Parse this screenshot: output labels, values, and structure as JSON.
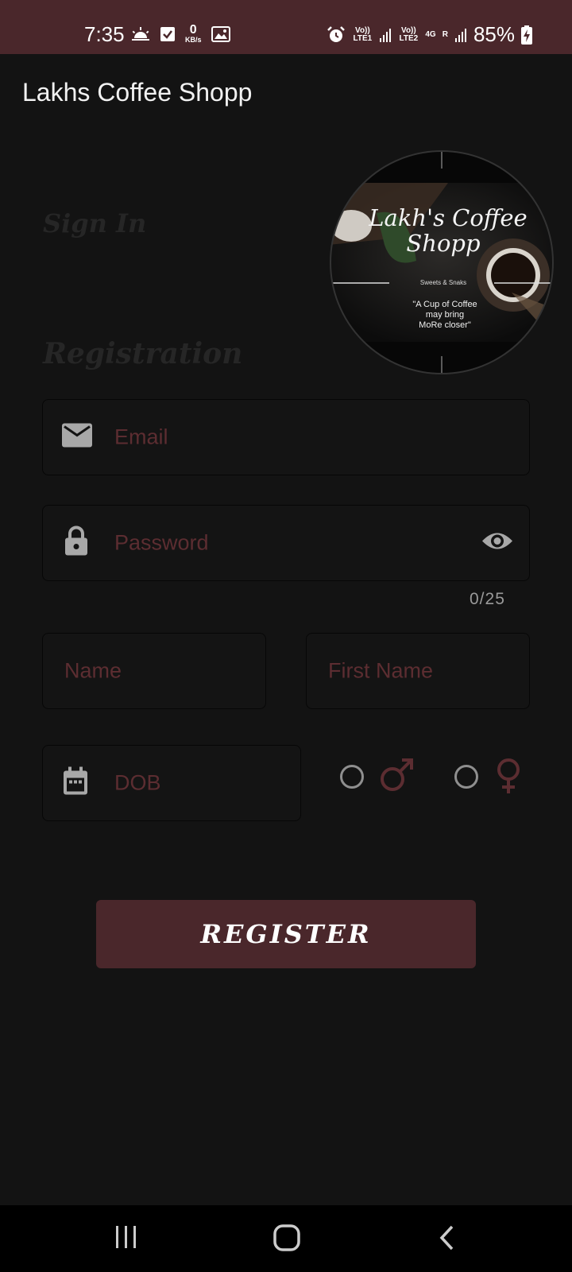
{
  "status_bar": {
    "time": "7:35",
    "speed_value": "0",
    "speed_unit": "KB/s",
    "sim1_label": "Vo)) LTE1",
    "sim2_label": "Vo)) LTE2",
    "network_type": "4G",
    "roaming": "R",
    "battery": "85%"
  },
  "app_bar": {
    "title": "Lakhs Coffee Shopp"
  },
  "tabs": {
    "sign_in": "Sign In",
    "registration": "Registration"
  },
  "logo": {
    "title_line1": "Lakh's Coffee",
    "title_line2": "Shopp",
    "subtitle": "Sweets & Snaks",
    "quote_line1": "\"A Cup of Coffee",
    "quote_line2": "may bring",
    "quote_line3": "MoRe closer\""
  },
  "form": {
    "email_placeholder": "Email",
    "password_placeholder": "Password",
    "password_counter": "0/25",
    "name_placeholder": "Name",
    "first_name_placeholder": "First Name",
    "dob_placeholder": "DOB",
    "register_label": "REGISTER"
  },
  "colors": {
    "accent": "#4a272b",
    "placeholder": "#5c2d31",
    "background": "#131313"
  }
}
